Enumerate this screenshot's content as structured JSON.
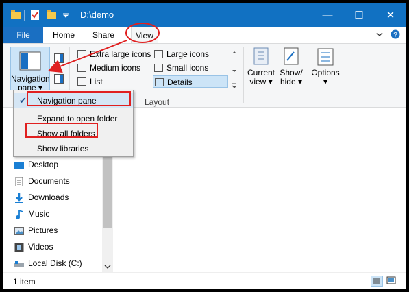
{
  "window": {
    "title": "D:\\demo",
    "controls": {
      "minimize": "—",
      "maximize": "☐",
      "close": "✕"
    }
  },
  "ribbon_tabs": [
    "File",
    "Home",
    "Share",
    "View"
  ],
  "ribbon": {
    "navigation_pane": {
      "line1": "Navigation",
      "line2": "pane ▾"
    },
    "layout": {
      "items": [
        "Extra large icons",
        "Large icons",
        "Medium icons",
        "Small icons",
        "List",
        "Details"
      ],
      "selected": "Details",
      "group_label": "Layout"
    },
    "current_view": {
      "line1": "Current",
      "line2": "view ▾"
    },
    "show_hide": {
      "line1": "Show/",
      "line2": "hide ▾"
    },
    "options": {
      "line1": "Options",
      "line2": "▾"
    }
  },
  "nav_pane_menu": {
    "items": [
      "Navigation pane",
      "Expand to open folder",
      "Show all folders",
      "Show libraries"
    ],
    "checked": "Navigation pane"
  },
  "navigation_tree": [
    "Desktop",
    "Documents",
    "Downloads",
    "Music",
    "Pictures",
    "Videos",
    "Local Disk (C:)"
  ],
  "status_bar": {
    "item_count": "1 item"
  },
  "colors": {
    "titlebar": "#1171c2",
    "file_tab": "#1a6fc2",
    "annotation": "#e02020",
    "selection": "#cce4f7"
  }
}
